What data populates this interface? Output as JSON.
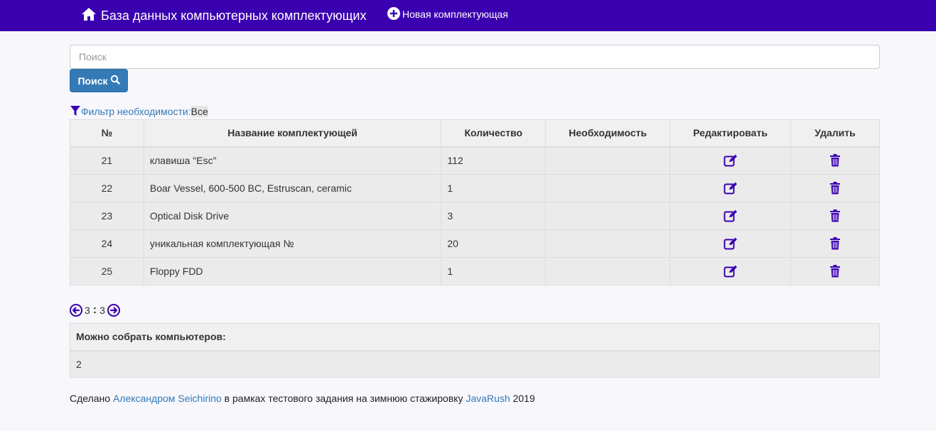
{
  "navbar": {
    "brand_label": "База данных компьютерных комплектующих",
    "brand_icon": "home-icon",
    "new_item_label": "Новая комплектующая",
    "new_item_icon": "plus-circle-icon",
    "background": "#3a00b0"
  },
  "search": {
    "placeholder": "Поиск",
    "value": "",
    "button_label": "Поиск",
    "button_icon": "search-icon"
  },
  "filter": {
    "label": "Фильтр необходимости:",
    "value": "Все",
    "icon": "funnel-icon"
  },
  "table": {
    "headers": {
      "num": "№",
      "name": "Название комплектующей",
      "quantity": "Количество",
      "necessity": "Необходимость",
      "edit": "Редактировать",
      "delete": "Удалить"
    },
    "rows": [
      {
        "num": "21",
        "name": "клавиша \"Esc\"",
        "quantity": "112",
        "necessity": ""
      },
      {
        "num": "22",
        "name": "Boar Vessel, 600-500 BC, Estruscan, ceramic",
        "quantity": "1",
        "necessity": ""
      },
      {
        "num": "23",
        "name": "Optical Disk Drive",
        "quantity": "3",
        "necessity": ""
      },
      {
        "num": "24",
        "name": "уникальная комплектующая №",
        "quantity": "20",
        "necessity": ""
      },
      {
        "num": "25",
        "name": "Floppy FDD",
        "quantity": "1",
        "necessity": ""
      }
    ],
    "edit_icon": "edit-icon",
    "delete_icon": "trash-icon",
    "icon_color": "#3a00b0"
  },
  "pagination": {
    "current": "3",
    "separator": ":",
    "total": "3",
    "prev_icon": "arrow-left-circle-icon",
    "next_icon": "arrow-right-circle-icon"
  },
  "summary": {
    "header": "Можно собрать компьютеров:",
    "value": "2"
  },
  "footer": {
    "text1": "Сделано ",
    "author_link": "Александром Seichirino",
    "text2": " в рамках тестового задания на зимнюю стажировку ",
    "company_link": "JavaRush",
    "text3": " 2019"
  }
}
